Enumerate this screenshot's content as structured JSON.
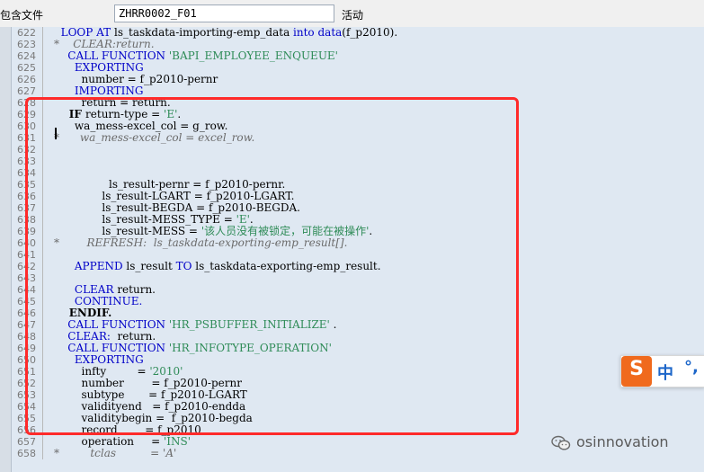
{
  "toolbar": {
    "label": "包含文件",
    "include_value": "ZHRR0002_F01",
    "status": "活动"
  },
  "editor": {
    "lines": [
      {
        "n": "622",
        "p": [
          [
            "kw",
            "  LOOP AT "
          ],
          [
            "",
            "ls_taskdata-importing-emp_data "
          ],
          [
            "kw",
            "into "
          ],
          [
            "kw",
            "data"
          ],
          [
            "",
            "(f_p2010)."
          ]
        ]
      },
      {
        "n": "623",
        "p": [
          [
            "cm",
            "*    CLEAR:return."
          ]
        ]
      },
      {
        "n": "624",
        "p": [
          [
            "kw",
            "    CALL FUNCTION "
          ],
          [
            "str",
            "'BAPI_EMPLOYEE_ENQUEUE'"
          ]
        ]
      },
      {
        "n": "625",
        "p": [
          [
            "kw",
            "      EXPORTING"
          ]
        ]
      },
      {
        "n": "626",
        "p": [
          [
            "",
            "        number = f_p2010-pernr"
          ]
        ]
      },
      {
        "n": "627",
        "p": [
          [
            "kw",
            "      IMPORTING"
          ]
        ]
      },
      {
        "n": "628",
        "p": [
          [
            "",
            "        return = return."
          ]
        ]
      },
      {
        "n": "629",
        "p": [
          [
            "kwb",
            "    IF "
          ],
          [
            "",
            "return-type = "
          ],
          [
            "str",
            "'E'"
          ],
          [
            "",
            "."
          ]
        ]
      },
      {
        "n": "630",
        "p": [
          [
            "",
            "      wa_mess-excel_col = g_row."
          ]
        ]
      },
      {
        "n": "631",
        "p": [
          [
            "cm",
            "*      wa_mess-excel_col = excel_row."
          ]
        ]
      },
      {
        "n": "632",
        "p": []
      },
      {
        "n": "633",
        "p": []
      },
      {
        "n": "634",
        "p": []
      },
      {
        "n": "635",
        "p": [
          [
            "",
            "                ls_result-pernr = f_p2010-pernr."
          ]
        ]
      },
      {
        "n": "636",
        "p": [
          [
            "",
            "              ls_result-LGART = f_p2010-LGART."
          ]
        ]
      },
      {
        "n": "637",
        "p": [
          [
            "",
            "              ls_result-BEGDA = f_p2010-BEGDA."
          ]
        ]
      },
      {
        "n": "638",
        "p": [
          [
            "",
            "              ls_result-MESS_TYPE = "
          ],
          [
            "str",
            "'E'"
          ],
          [
            "",
            "."
          ]
        ]
      },
      {
        "n": "639",
        "p": [
          [
            "",
            "              ls_result-MESS = "
          ],
          [
            "str",
            "'该人员没有被锁定，可能在被操作'"
          ],
          [
            "",
            "."
          ]
        ]
      },
      {
        "n": "640",
        "p": [
          [
            "cm",
            "*        REFRESH:  ls_taskdata-exporting-emp_result[]."
          ]
        ]
      },
      {
        "n": "641",
        "p": []
      },
      {
        "n": "642",
        "p": [
          [
            "kw",
            "      APPEND "
          ],
          [
            "",
            "ls_result "
          ],
          [
            "kw",
            "TO "
          ],
          [
            "",
            "ls_taskdata-exporting-emp_result."
          ]
        ]
      },
      {
        "n": "643",
        "p": []
      },
      {
        "n": "644",
        "p": [
          [
            "kw",
            "      CLEAR "
          ],
          [
            "",
            "return."
          ]
        ]
      },
      {
        "n": "645",
        "p": [
          [
            "kw",
            "      CONTINUE."
          ]
        ]
      },
      {
        "n": "646",
        "p": [
          [
            "kwb",
            "    ENDIF."
          ]
        ]
      },
      {
        "n": "647",
        "p": [
          [
            "kw",
            "    CALL FUNCTION "
          ],
          [
            "str",
            "'HR_PSBUFFER_INITIALIZE'"
          ],
          [
            "",
            " ."
          ]
        ]
      },
      {
        "n": "648",
        "p": [
          [
            "kw",
            "    CLEAR:  "
          ],
          [
            "",
            "return."
          ]
        ]
      },
      {
        "n": "649",
        "p": [
          [
            "kw",
            "    CALL FUNCTION "
          ],
          [
            "str",
            "'HR_INFOTYPE_OPERATION'"
          ]
        ]
      },
      {
        "n": "650",
        "p": [
          [
            "kw",
            "      EXPORTING"
          ]
        ]
      },
      {
        "n": "651",
        "p": [
          [
            "",
            "        infty         = "
          ],
          [
            "str",
            "'2010'"
          ]
        ]
      },
      {
        "n": "652",
        "p": [
          [
            "",
            "        number        = f_p2010-pernr"
          ]
        ]
      },
      {
        "n": "653",
        "p": [
          [
            "",
            "        subtype       = f_p2010-LGART"
          ]
        ]
      },
      {
        "n": "654",
        "p": [
          [
            "",
            "        validityend   = f_p2010-endda"
          ]
        ]
      },
      {
        "n": "655",
        "p": [
          [
            "",
            "        validitybegin =  f_p2010-begda"
          ]
        ]
      },
      {
        "n": "656",
        "p": [
          [
            "",
            "        record        = f_p2010"
          ]
        ]
      },
      {
        "n": "657",
        "p": [
          [
            "",
            "        operation     = "
          ],
          [
            "str",
            "'INS'"
          ]
        ]
      },
      {
        "n": "658",
        "p": [
          [
            "cm",
            "*         tclas          = 'A'"
          ]
        ]
      }
    ]
  },
  "ime": {
    "logo": "S",
    "mode": "中",
    "punct": "°,"
  },
  "watermark": {
    "text": "osinnovation",
    "icon": "wechat-icon"
  },
  "colors": {
    "keyword": "#0000c8",
    "string": "#2e8b57",
    "comment": "#6b6b6b",
    "highlight_box": "#ff2a2a",
    "editor_bg": "#dfe8f2"
  }
}
